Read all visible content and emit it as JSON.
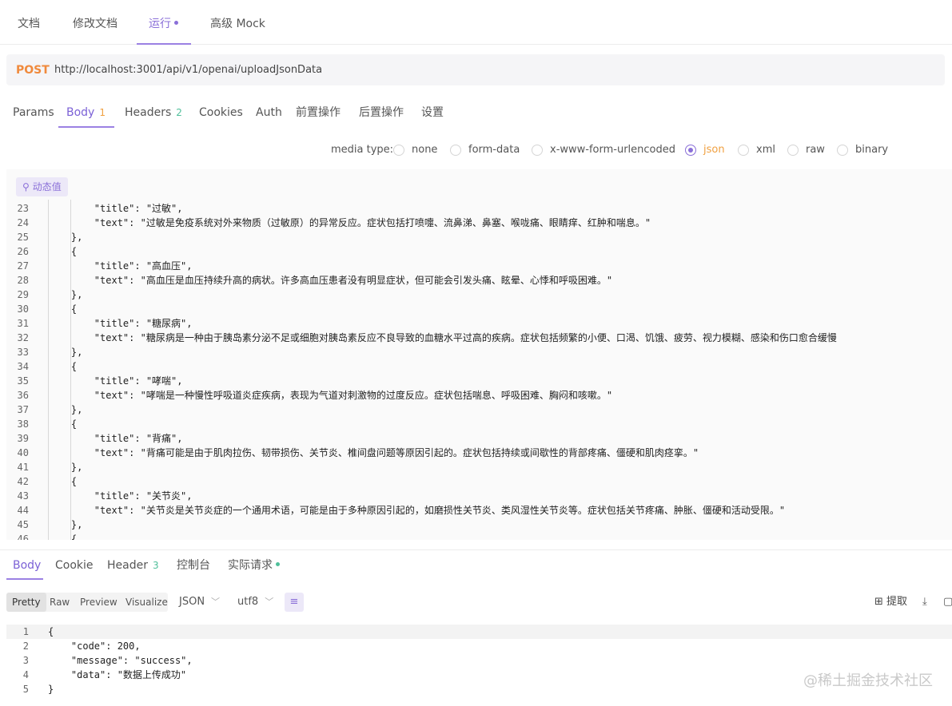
{
  "top_tabs": [
    {
      "label": "文档"
    },
    {
      "label": "修改文档"
    },
    {
      "label": "运行"
    },
    {
      "label": "高级 Mock"
    }
  ],
  "request": {
    "method": "POST",
    "url": "http://localhost:3001/api/v1/openai/uploadJsonData"
  },
  "request_tabs": [
    {
      "label": "Params"
    },
    {
      "label": "Body",
      "count": "1"
    },
    {
      "label": "Headers",
      "count": "2"
    },
    {
      "label": "Cookies"
    },
    {
      "label": "Auth"
    },
    {
      "label": "前置操作"
    },
    {
      "label": "后置操作"
    },
    {
      "label": "设置"
    }
  ],
  "media_type": {
    "label": "media type:",
    "options": [
      "none",
      "form-data",
      "x-www-form-urlencoded",
      "json",
      "xml",
      "raw",
      "binary"
    ],
    "selected": "json"
  },
  "editor": {
    "dynamic_value_label": "动态值",
    "lines": [
      {
        "num": "23",
        "text": "        \"title\": \"过敏\","
      },
      {
        "num": "24",
        "text": "        \"text\": \"过敏是免疫系统对外来物质（过敏原）的异常反应。症状包括打喷嚏、流鼻涕、鼻塞、喉咙痛、眼睛痒、红肿和喘息。\""
      },
      {
        "num": "25",
        "text": "    },"
      },
      {
        "num": "26",
        "text": "    {"
      },
      {
        "num": "27",
        "text": "        \"title\": \"高血压\","
      },
      {
        "num": "28",
        "text": "        \"text\": \"高血压是血压持续升高的病状。许多高血压患者没有明显症状，但可能会引发头痛、眩晕、心悸和呼吸困难。\""
      },
      {
        "num": "29",
        "text": "    },"
      },
      {
        "num": "30",
        "text": "    {"
      },
      {
        "num": "31",
        "text": "        \"title\": \"糖尿病\","
      },
      {
        "num": "32",
        "text": "        \"text\": \"糖尿病是一种由于胰岛素分泌不足或细胞对胰岛素反应不良导致的血糖水平过高的疾病。症状包括频繁的小便、口渴、饥饿、疲劳、视力模糊、感染和伤口愈合缓慢"
      },
      {
        "num": "33",
        "text": "    },"
      },
      {
        "num": "34",
        "text": "    {"
      },
      {
        "num": "35",
        "text": "        \"title\": \"哮喘\","
      },
      {
        "num": "36",
        "text": "        \"text\": \"哮喘是一种慢性呼吸道炎症疾病，表现为气道对刺激物的过度反应。症状包括喘息、呼吸困难、胸闷和咳嗽。\""
      },
      {
        "num": "37",
        "text": "    },"
      },
      {
        "num": "38",
        "text": "    {"
      },
      {
        "num": "39",
        "text": "        \"title\": \"背痛\","
      },
      {
        "num": "40",
        "text": "        \"text\": \"背痛可能是由于肌肉拉伤、韧带损伤、关节炎、椎间盘问题等原因引起的。症状包括持续或间歇性的背部疼痛、僵硬和肌肉痉挛。\""
      },
      {
        "num": "41",
        "text": "    },"
      },
      {
        "num": "42",
        "text": "    {"
      },
      {
        "num": "43",
        "text": "        \"title\": \"关节炎\","
      },
      {
        "num": "44",
        "text": "        \"text\": \"关节炎是关节炎症的一个通用术语，可能是由于多种原因引起的，如磨损性关节炎、类风湿性关节炎等。症状包括关节疼痛、肿胀、僵硬和活动受限。\""
      },
      {
        "num": "45",
        "text": "    },"
      },
      {
        "num": "46",
        "text": "    {"
      }
    ]
  },
  "response_tabs": [
    {
      "label": "Body"
    },
    {
      "label": "Cookie"
    },
    {
      "label": "Header",
      "count": "3"
    },
    {
      "label": "控制台"
    },
    {
      "label": "实际请求"
    }
  ],
  "response_toolbar": {
    "views": [
      "Pretty",
      "Raw",
      "Preview",
      "Visualize"
    ],
    "active_view": "Pretty",
    "format": "JSON",
    "encoding": "utf8",
    "extract_label": "提取"
  },
  "response_body": [
    {
      "num": "1",
      "text": "{"
    },
    {
      "num": "2",
      "text": "    \"code\": 200,"
    },
    {
      "num": "3",
      "text": "    \"message\": \"success\","
    },
    {
      "num": "4",
      "text": "    \"data\": \"数据上传成功\""
    },
    {
      "num": "5",
      "text": "}"
    }
  ],
  "watermark": "@稀土掘金技术社区",
  "colors": {
    "accent": "#8a6fd8",
    "method_post": "#f08a3c",
    "json_selected": "#f0a040",
    "count_green": "#4fbf9a"
  }
}
